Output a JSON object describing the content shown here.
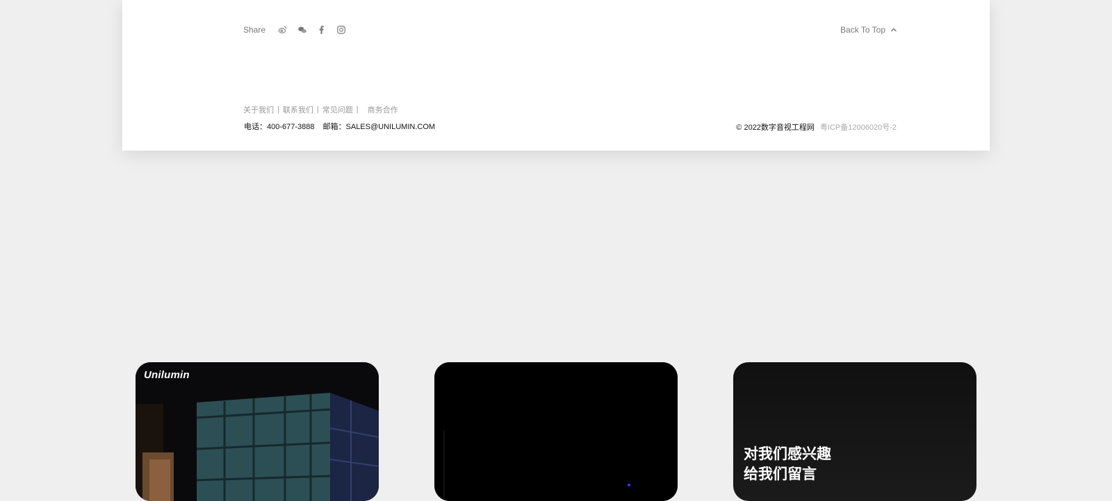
{
  "footer": {
    "share_label": "Share",
    "share_icons": [
      "weibo-icon",
      "wechat-icon",
      "facebook-icon",
      "instagram-icon"
    ],
    "back_to_top": "Back To Top",
    "links": [
      "关于我们",
      "联系我们",
      "常见问题",
      "商务合作"
    ],
    "separator": "|",
    "phone": "电话：400-677-3888",
    "email": "邮箱：SALES@UNILUMIN.COM",
    "copyright": "© 2022数字音视工程网",
    "icp": "粤ICP备12006020号-2"
  },
  "cards": [
    {
      "brand": "Unilumin"
    },
    {},
    {
      "line1": "对我们感兴趣",
      "line2": "给我们留言"
    }
  ],
  "colors": {
    "background": "#efefef",
    "panel": "#ffffff",
    "muted_text": "#777777",
    "link_text": "#999999"
  }
}
